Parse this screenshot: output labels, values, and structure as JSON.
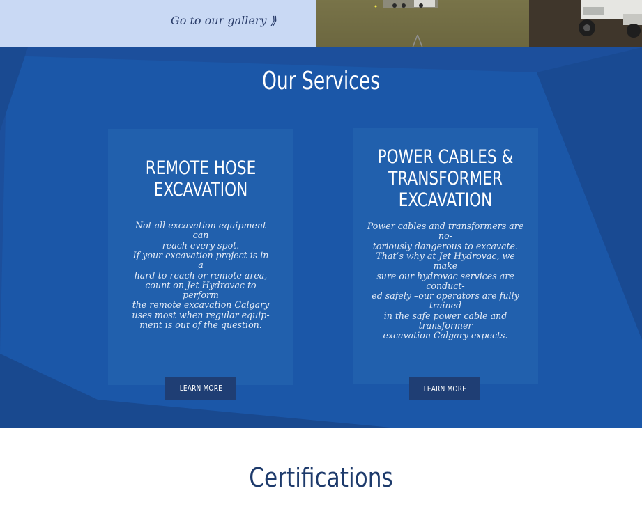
{
  "gallery": {
    "link_text": "Go to our gallery ⟫"
  },
  "services": {
    "title": "Our Services",
    "cards": [
      {
        "title_lines": [
          "REMOTE HOSE",
          "EXCAVATION"
        ],
        "paragraph1_lines": [
          "Not all excavation equipment can",
          "reach every spot."
        ],
        "paragraph2_lines": [
          "If your excavation project is in a",
          "hard-to-reach or remote area,",
          "count on Jet Hydrovac to perform",
          "the remote excavation Calgary",
          "uses most when regular equip-",
          "ment is out of the question."
        ],
        "button_label": "LEARN MORE"
      },
      {
        "title_lines": [
          "POWER CABLES &",
          "TRANSFORMER",
          "EXCAVATION"
        ],
        "paragraph1_lines": [
          "Power cables and transformers are no-",
          "toriously dangerous to excavate."
        ],
        "paragraph2_lines": [
          "That’s why at Jet Hydrovac, we make",
          "sure our hydrovac services are conduct-",
          "ed safely –our operators are fully trained",
          "in the safe power cable and transformer",
          "excavation Calgary expects."
        ],
        "button_label": "LEARN MORE"
      }
    ]
  },
  "certifications": {
    "title": "Certifications"
  },
  "colors": {
    "gallery_panel": "#c9d9f4",
    "services_bg": "#1b4f9a",
    "card_bg": "#2160ad",
    "button_bg": "#1f3e74",
    "heading_dark": "#1d3a6b"
  }
}
